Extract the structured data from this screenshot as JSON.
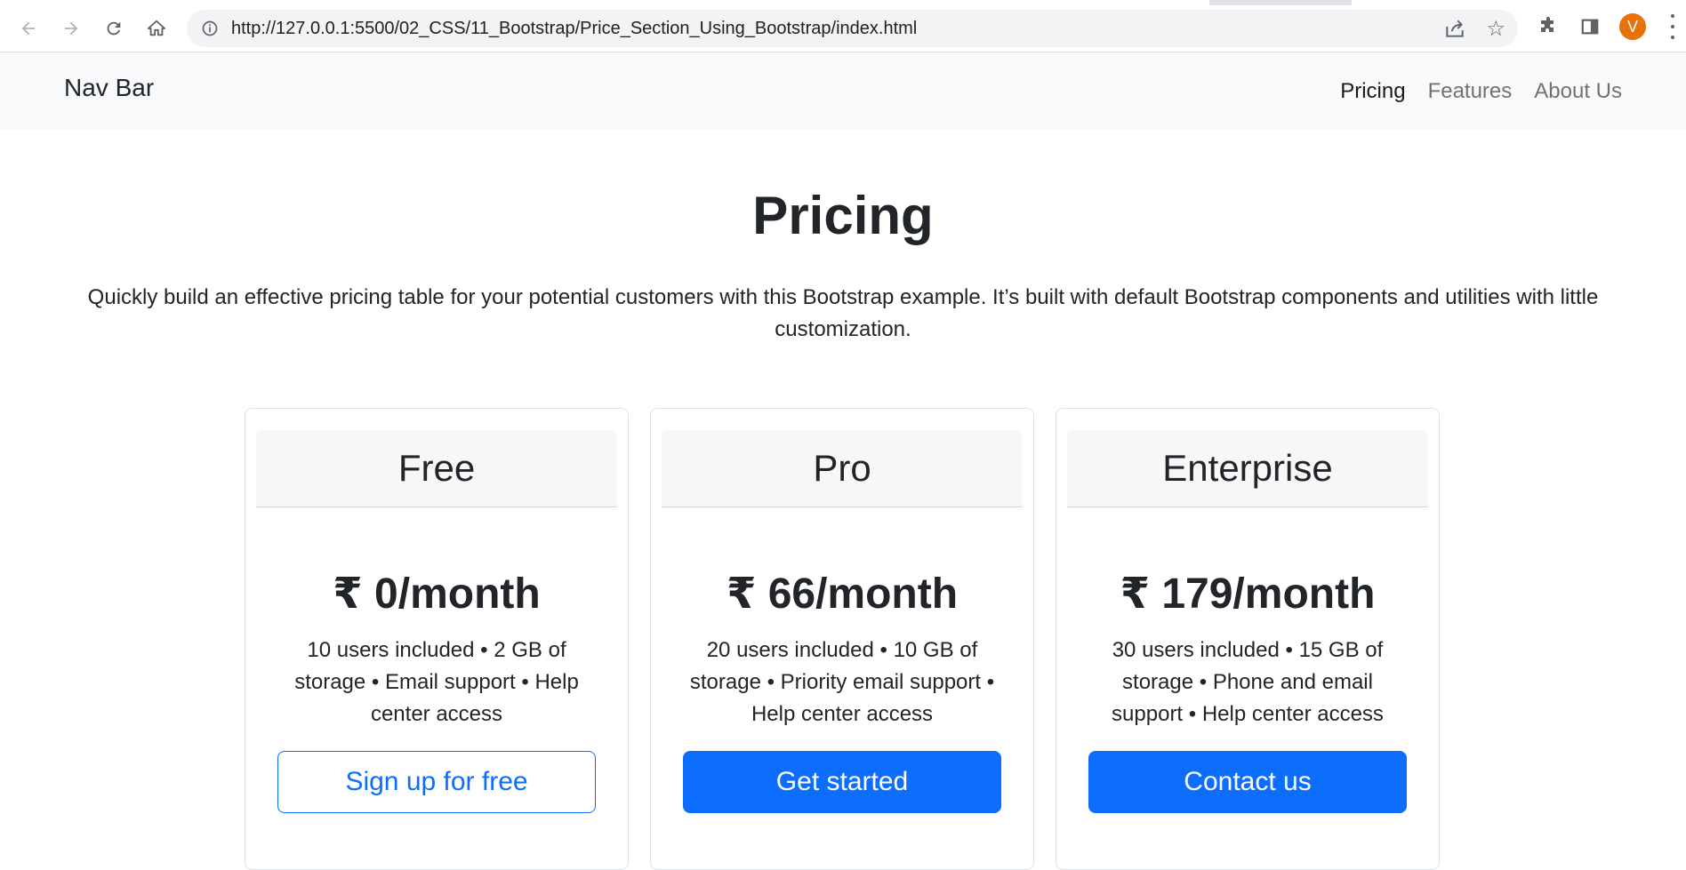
{
  "browser": {
    "url": "http://127.0.0.1:5500/02_CSS/11_Bootstrap/Price_Section_Using_Bootstrap/index.html",
    "profile_initial": "V"
  },
  "navbar": {
    "brand": "Nav Bar",
    "links": [
      "Pricing",
      "Features",
      "About Us"
    ]
  },
  "hero": {
    "title": "Pricing",
    "lead": "Quickly build an effective pricing table for your potential customers with this Bootstrap example. It’s built with default Bootstrap components and utilities with little customization."
  },
  "plans": [
    {
      "name": "Free",
      "price": "₹ 0/month",
      "description": "10 users included • 2 GB of storage • Email support • Help center access",
      "button": "Sign up for free"
    },
    {
      "name": "Pro",
      "price": "₹ 66/month",
      "description": "20 users included • 10 GB of storage • Priority email support • Help center access",
      "button": "Get started"
    },
    {
      "name": "Enterprise",
      "price": "₹ 179/month",
      "description": "30 users included • 15 GB of storage • Phone and email support • Help center access",
      "button": "Contact us"
    }
  ],
  "colors": {
    "primary": "#0d6efd",
    "navbar_bg": "#f8f9fa",
    "text": "#212529"
  },
  "icons": [
    "back-arrow-icon",
    "forward-arrow-icon",
    "reload-icon",
    "home-icon",
    "info-icon",
    "share-icon",
    "star-icon",
    "puzzle-icon",
    "side-panel-icon",
    "kebab-menu-icon"
  ]
}
